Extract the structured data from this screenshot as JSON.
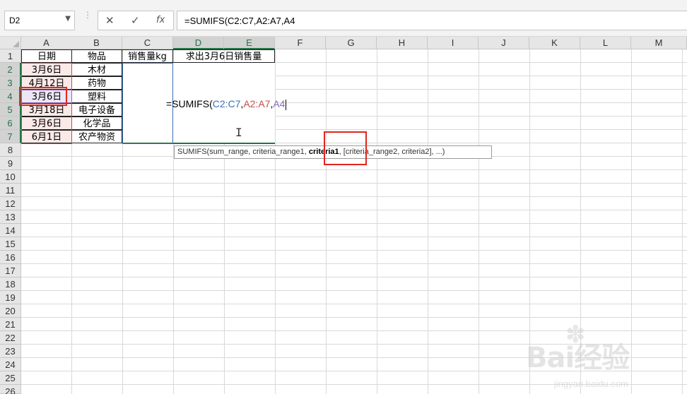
{
  "name_box": {
    "value": "D2",
    "arrow": "▼"
  },
  "formula_bar": {
    "cancel_icon": "✕",
    "enter_icon": "✓",
    "fx_label": "fx",
    "value": "=SUMIFS(C2:C7,A2:A7,A4"
  },
  "columns": [
    "A",
    "B",
    "C",
    "D",
    "E",
    "F",
    "G",
    "H",
    "I",
    "J",
    "K",
    "L",
    "M"
  ],
  "selected_columns": [
    "D",
    "E"
  ],
  "rows": [
    "1",
    "2",
    "3",
    "4",
    "5",
    "6",
    "7",
    "8",
    "9",
    "10",
    "11",
    "12",
    "13",
    "14",
    "15",
    "16",
    "17",
    "18",
    "19",
    "20",
    "21",
    "22",
    "23",
    "24",
    "25",
    "26"
  ],
  "selected_rows": [
    "2",
    "3",
    "4",
    "5",
    "6",
    "7"
  ],
  "cells": {
    "A1": "日期",
    "B1": "物品",
    "C1": "销售量kg",
    "D1": "求出3月6日销售量",
    "A2": "3月6日",
    "B2": "木材",
    "A3": "4月12日",
    "B3": "药物",
    "A4": "3月6日",
    "B4": "塑料",
    "A5": "3月18日",
    "B5": "电子设备",
    "A6": "3月6日",
    "B6": "化学品",
    "A7": "6月1日",
    "B7": "农产物资"
  },
  "editing": {
    "prefix": "=SUMIFS(",
    "ref1": "C2:C7",
    "sep1": ",",
    "ref2": "A2:A7",
    "sep2": ",",
    "ref3": "A4"
  },
  "tooltip": {
    "before": "SUMIFS(sum_range, criteria_range1, ",
    "current": "criteria1",
    "after": ", [criteria_range2, criteria2], ...)"
  },
  "colors": {
    "ref1": "#3a6fb5",
    "ref2": "#c0504d",
    "ref3": "#8a6bbf",
    "highlight": "#e0261d",
    "excel_green": "#217346"
  },
  "watermark": {
    "logo": "Bai经验",
    "sub": "jingyan.baidu.com"
  }
}
